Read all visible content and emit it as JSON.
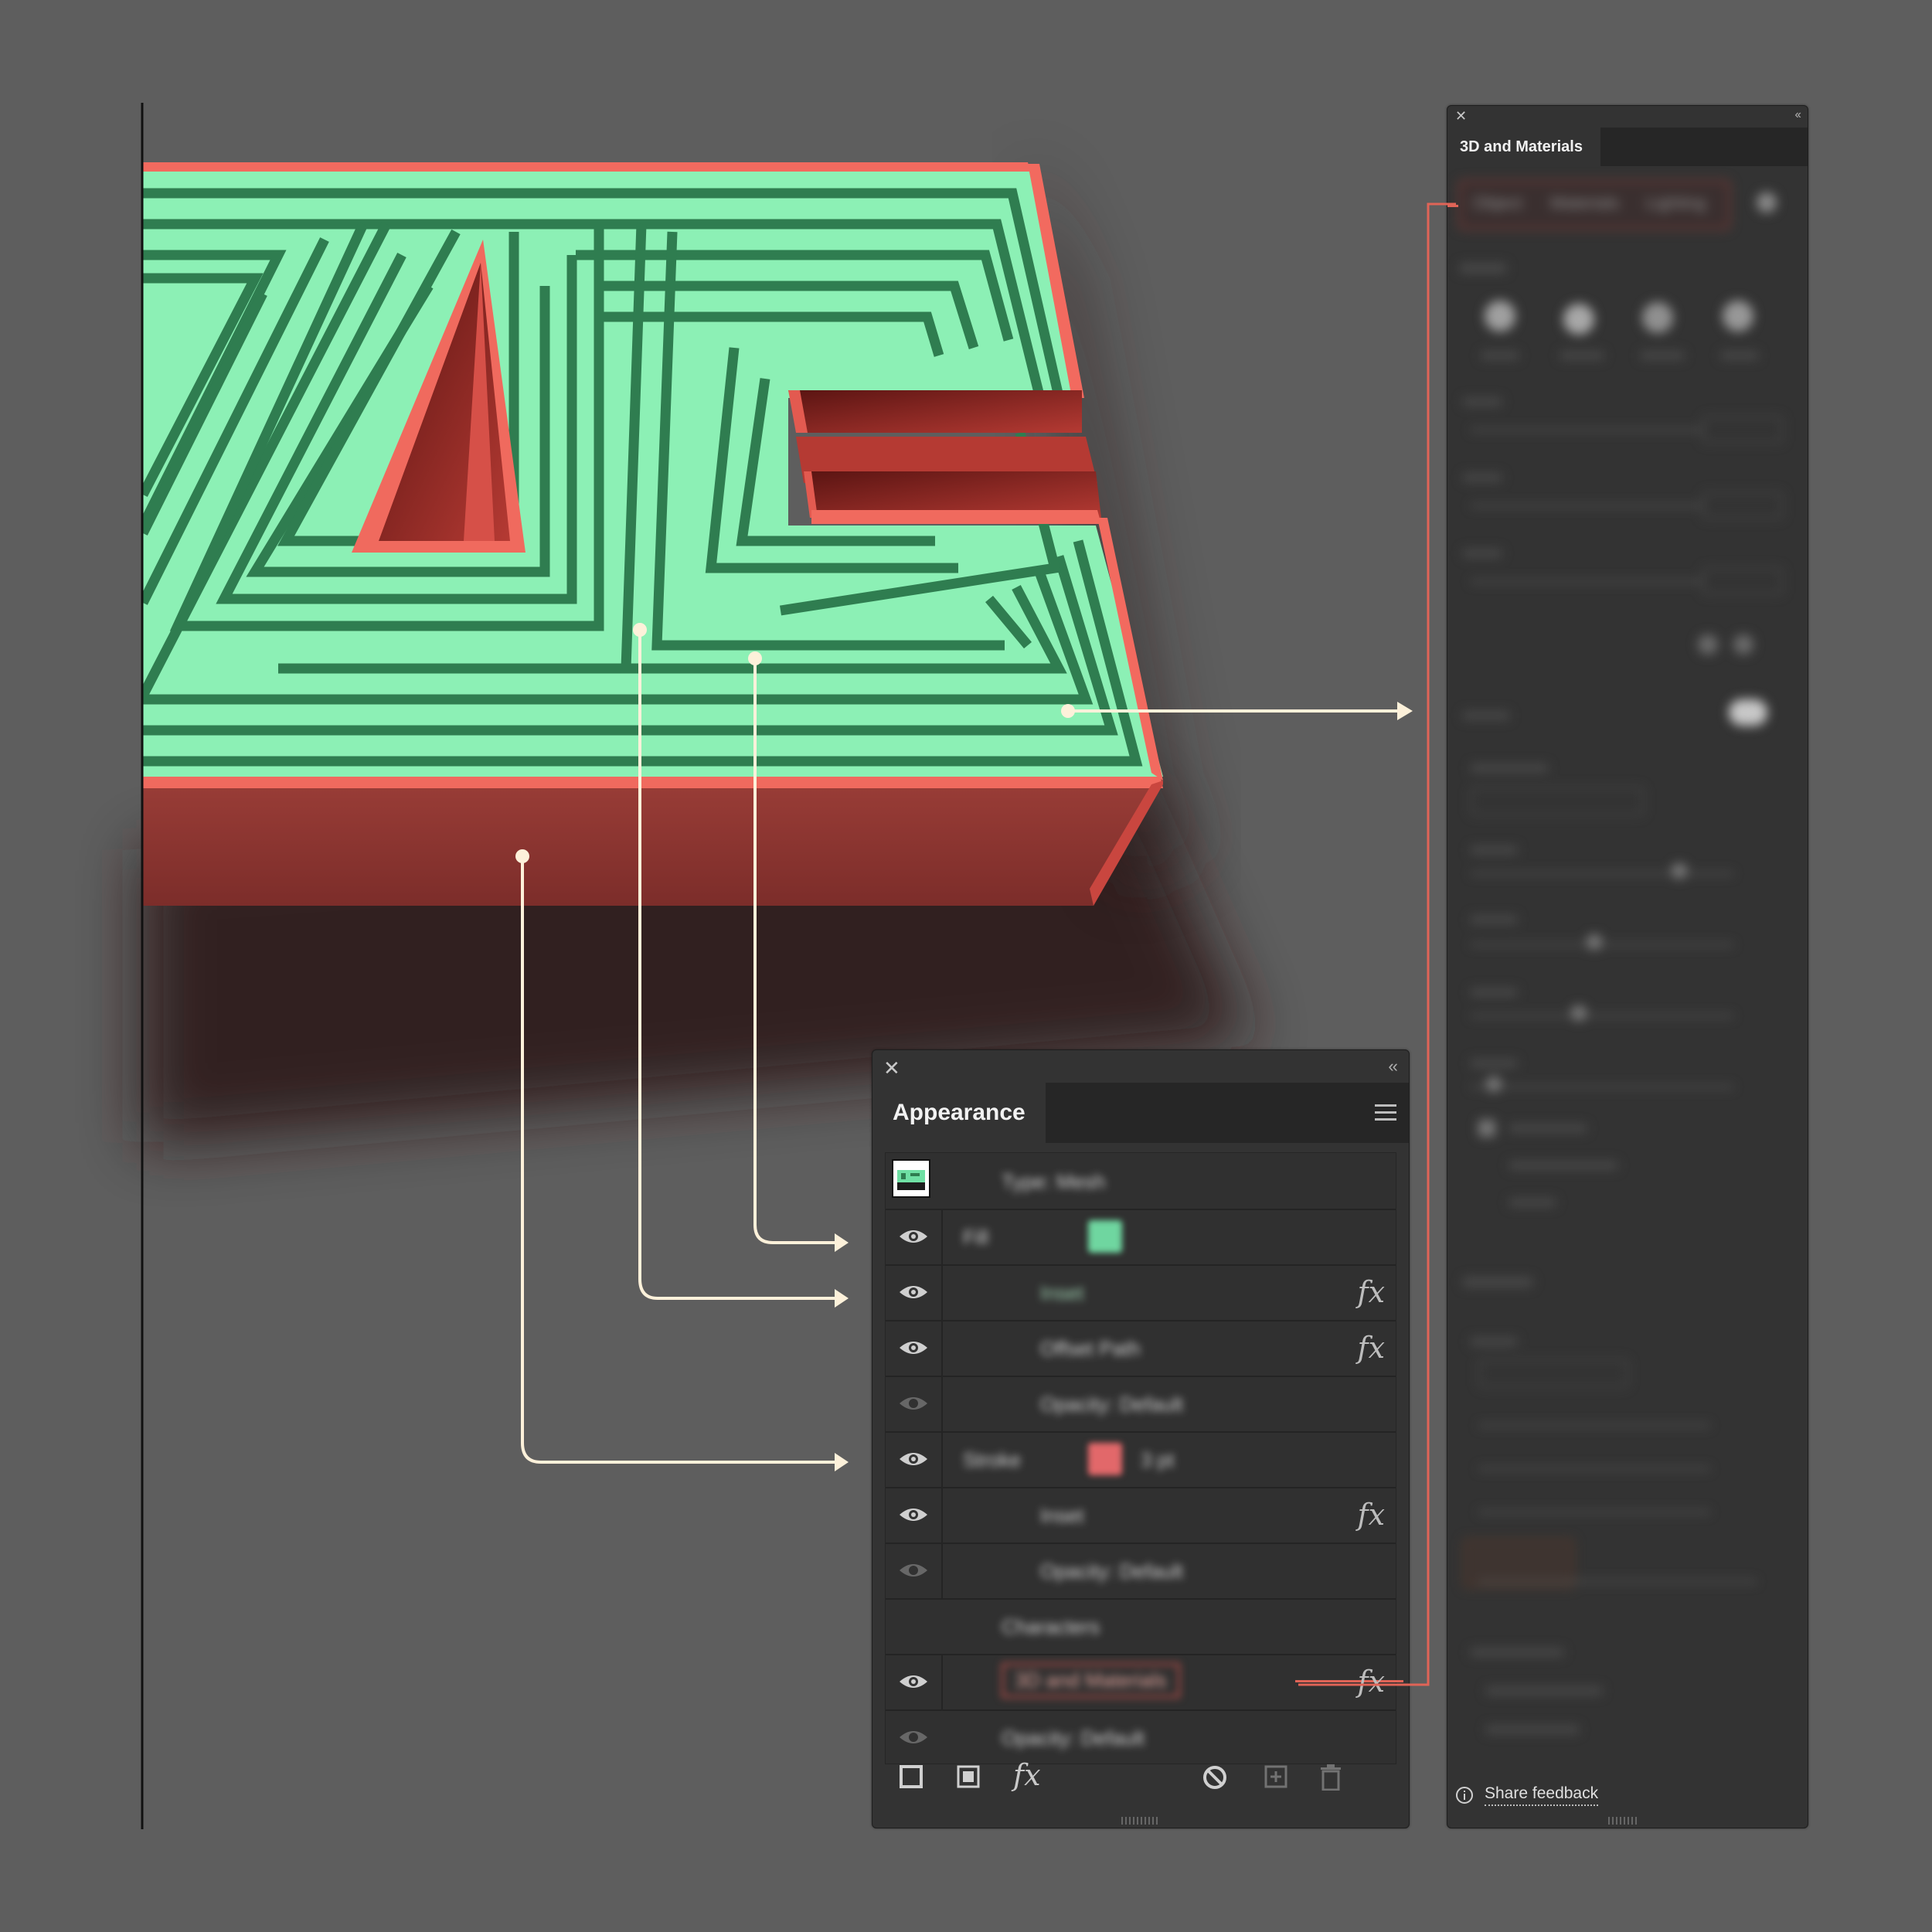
{
  "colors": {
    "canvas": "#5e5e5e",
    "panel": "#333333",
    "maze_top": "#88f0b4",
    "maze_groove": "#2f7d50",
    "maze_side": "#e2584e",
    "maze_side_dark": "#8a3530",
    "callout": "#fdf1da",
    "link_line": "#e06457"
  },
  "appearance": {
    "title": "Appearance",
    "rows": [
      {
        "label": "Type: Mesh",
        "icon": "thumbnail"
      },
      {
        "label": "Fill",
        "eye": "visible",
        "swatch": "#6fd6a0"
      },
      {
        "label": "Inset",
        "eye": "visible",
        "fx": "fx"
      },
      {
        "label": "Offset Path",
        "eye": "visible",
        "fx": "fx"
      },
      {
        "label": "Opacity: Default",
        "eye": "dim"
      },
      {
        "label": "Stroke",
        "eye": "visible",
        "swatch": "#e2686a",
        "extra": "3 pt"
      },
      {
        "label": "Inset",
        "eye": "visible",
        "fx": "fx"
      },
      {
        "label": "Opacity: Default",
        "eye": "dim"
      },
      {
        "label": "Characters"
      },
      {
        "label": "3D and Materials",
        "eye": "visible",
        "fx": "fx"
      },
      {
        "label": "Opacity: Default",
        "eye": "dim"
      }
    ],
    "footer": {
      "fx_label": "fx"
    }
  },
  "materials": {
    "title": "3D and Materials",
    "tabs": [
      "Object",
      "Materials",
      "Lighting"
    ],
    "feedback_label": "Share feedback"
  }
}
